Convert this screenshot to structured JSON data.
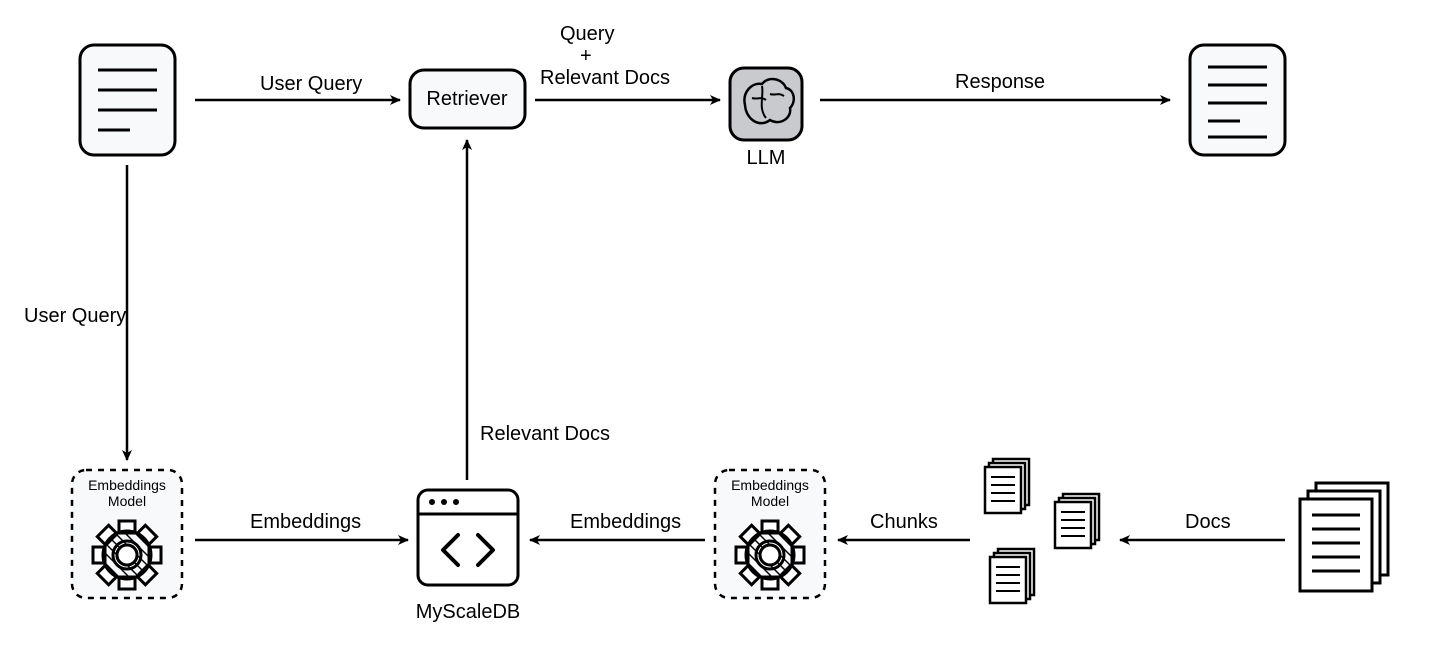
{
  "nodes": {
    "query_doc": "",
    "retriever": "Retriever",
    "llm": "LLM",
    "response_doc": "",
    "embeddings_model_left": "Embeddings\nModel",
    "embeddings_model_right": "Embeddings\nModel",
    "myscaledb": "MyScaleDB",
    "docs_stack": ""
  },
  "edges": {
    "user_query_right": "User Query",
    "user_query_down": "User Query",
    "query_plus_docs_line1": "Query",
    "query_plus_docs_line2": "+",
    "query_plus_docs_line3": "Relevant Docs",
    "response": "Response",
    "relevant_docs_up": "Relevant Docs",
    "embeddings_left": "Embeddings",
    "embeddings_right": "Embeddings",
    "chunks": "Chunks",
    "docs": "Docs"
  }
}
